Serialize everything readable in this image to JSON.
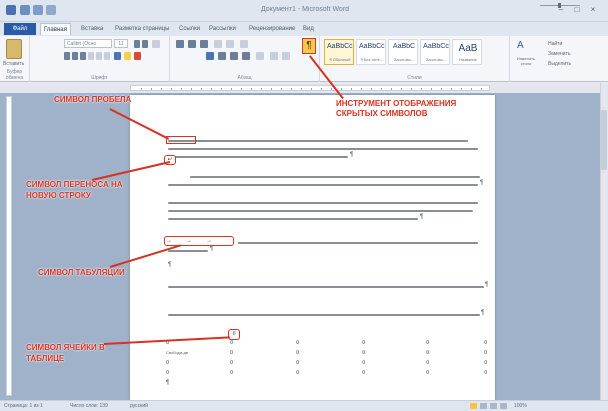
{
  "window": {
    "title": "Документ1 - Microsoft Word",
    "controls": [
      "–",
      "□",
      "×"
    ]
  },
  "ribbon_tabs": {
    "file": "Файл",
    "tabs": [
      "Главная",
      "Вставка",
      "Разметка страницы",
      "Ссылки",
      "Рассылки",
      "Рецензирование",
      "Вид"
    ],
    "active_index": 0
  },
  "ribbon": {
    "clipboard": {
      "paste_label": "Вставить",
      "group_label": "Буфер обмена"
    },
    "font": {
      "font_name": "Calibri (Осно",
      "font_size": "11",
      "group_label": "Шрифт"
    },
    "paragraph": {
      "group_label": "Абзац",
      "show_marks_glyph": "¶"
    },
    "styles": {
      "group_label": "Стили",
      "items": [
        {
          "sample": "AaBbCcI",
          "name": "¶ Обычный"
        },
        {
          "sample": "AaBbCcI",
          "name": "¶ Без инте..."
        },
        {
          "sample": "AaBbC",
          "name": "Заголово..."
        },
        {
          "sample": "AaBbCc",
          "name": "Заголово..."
        },
        {
          "sample": "AaB",
          "name": "Название"
        }
      ],
      "change_styles_glyph": "A",
      "change_styles_label": "Изменить стили"
    },
    "editing": {
      "find": "Найти",
      "replace": "Заменить",
      "select": "Выделить"
    }
  },
  "annotations": {
    "space": "СИМВОЛ ПРОБЕЛА",
    "hidden_tool_line1": "ИНСТРУМЕНТ ОТОБРАЖЕНИЯ",
    "hidden_tool_line2": "СКРЫТЫХ СИМВОЛОВ",
    "newline_line1": "СИМВОЛ ПЕРЕНОСА НА",
    "newline_line2": "НОВУЮ СТРОКУ",
    "tab": "СИМВОЛ ТАБУЛЯЦИИ",
    "cell_line1": "СИМВОЛ ЯЧЕЙКИ В",
    "cell_line2": "ТАБЛИЦЕ"
  },
  "document": {
    "pilcrow": "¶",
    "newline_glyph": "↵",
    "tab_glyph": "→",
    "cell_glyph": "¤",
    "table_first_cell": "Свобода-дв"
  },
  "status": {
    "page": "Страница: 1 из 1",
    "words": "Число слов: 139",
    "language": "русский",
    "zoom": "100%"
  },
  "colors": {
    "annotation": "#d63322",
    "highlight_button": "#f5c94b",
    "workspace": "#9fb2c9",
    "file_tab": "#2a5ba8"
  }
}
